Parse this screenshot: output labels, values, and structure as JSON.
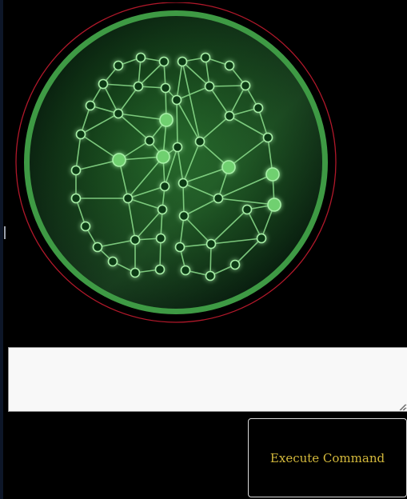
{
  "emblem": {
    "icon": "neural-brain-icon",
    "glow_color": "#5fd35f",
    "ring_color": "#3e9a44",
    "outline_color": "#b0182a"
  },
  "command": {
    "value": "",
    "placeholder": ""
  },
  "execute_button": {
    "label": "Execute Command",
    "text_color": "#d4b93c"
  }
}
